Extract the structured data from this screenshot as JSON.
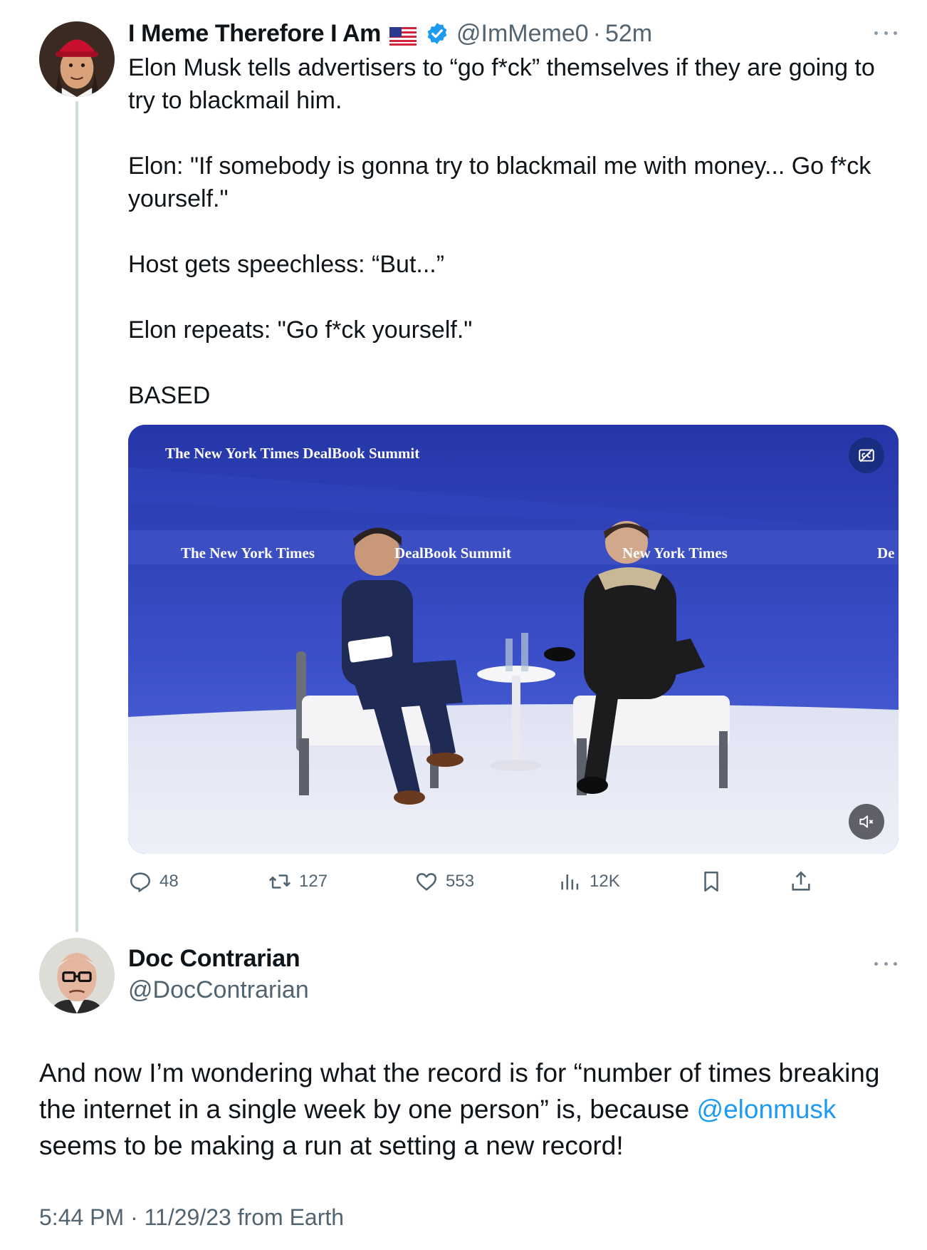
{
  "quoted_tweet": {
    "display_name": "I Meme Therefore I Am",
    "flag": "us-flag-emoji",
    "verified": true,
    "handle": "@ImMeme0",
    "separator": "·",
    "time": "52m",
    "body": [
      "Elon Musk tells advertisers to “go f*ck” themselves if they are going to try to blackmail him.",
      "Elon: \"If somebody is gonna try to blackmail me with money... Go f*ck yourself.\"",
      "Host gets speechless: “But...”",
      "Elon repeats: \"Go f*ck yourself.\"",
      "BASED"
    ],
    "media": {
      "type": "video",
      "banner_top": "The New York Times DealBook Summit",
      "band_left": "The New York Times",
      "band_center": "DealBook Summit",
      "band_right": "New York Times",
      "band_edge": "De",
      "buttons": [
        "captions-icon",
        "mute-icon"
      ]
    },
    "actions": {
      "replies": "48",
      "retweets": "127",
      "likes": "553",
      "views": "12K"
    }
  },
  "main_tweet": {
    "display_name": "Doc Contrarian",
    "handle": "@DocContrarian",
    "text_before_mention": "And now I’m wondering what the record is for “number of times breaking the internet in a single week by one person” is, because ",
    "mention": "@elonmusk",
    "text_after_mention": " seems to be making a run at setting a new record!",
    "timestamp": "5:44 PM · 11/29/23 from Earth"
  },
  "colors": {
    "text": "#0f1419",
    "secondary": "#536471",
    "link": "#1d9bf0",
    "verified": "#1d9bf0",
    "thread_line": "#cfd9de"
  }
}
